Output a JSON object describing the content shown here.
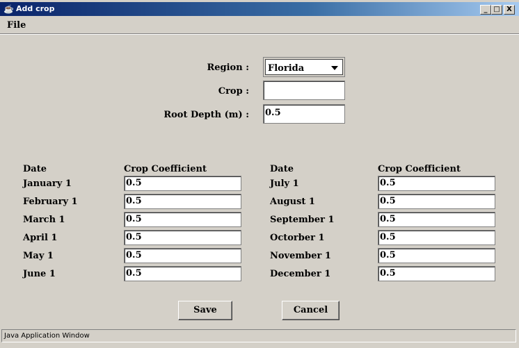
{
  "window": {
    "title": "Add crop",
    "controls": {
      "minimize": "_",
      "maximize": "□",
      "close": "X"
    }
  },
  "menu": {
    "file": "File"
  },
  "form": {
    "region_label": "Region :",
    "region_value": "Florida",
    "crop_label": "Crop :",
    "crop_value": "",
    "root_depth_label": "Root Depth (m) :",
    "root_depth_value": "0.5"
  },
  "table": {
    "left": {
      "date_header": "Date",
      "coef_header": "Crop Coefficient",
      "rows": [
        {
          "date": "January 1",
          "value": "0.5"
        },
        {
          "date": "February 1",
          "value": "0.5"
        },
        {
          "date": "March 1",
          "value": "0.5"
        },
        {
          "date": "April 1",
          "value": "0.5"
        },
        {
          "date": "May 1",
          "value": "0.5"
        },
        {
          "date": "June 1",
          "value": "0.5"
        }
      ]
    },
    "right": {
      "date_header": "Date",
      "coef_header": "Crop Coefficient",
      "rows": [
        {
          "date": "July 1",
          "value": "0.5"
        },
        {
          "date": "August 1",
          "value": "0.5"
        },
        {
          "date": "September 1",
          "value": "0.5"
        },
        {
          "date": "Octorber 1",
          "value": "0.5"
        },
        {
          "date": "November 1",
          "value": "0.5"
        },
        {
          "date": "December 1",
          "value": "0.5"
        }
      ]
    }
  },
  "buttons": {
    "save": "Save",
    "cancel": "Cancel"
  },
  "status": {
    "text": "Java Application Window"
  },
  "icons": {
    "app": "java-cup-icon",
    "dropdown": "chevron-down-icon"
  },
  "colors": {
    "titlebar_start": "#0a246a",
    "titlebar_end": "#a6caf0",
    "background": "#d4d0c8"
  }
}
